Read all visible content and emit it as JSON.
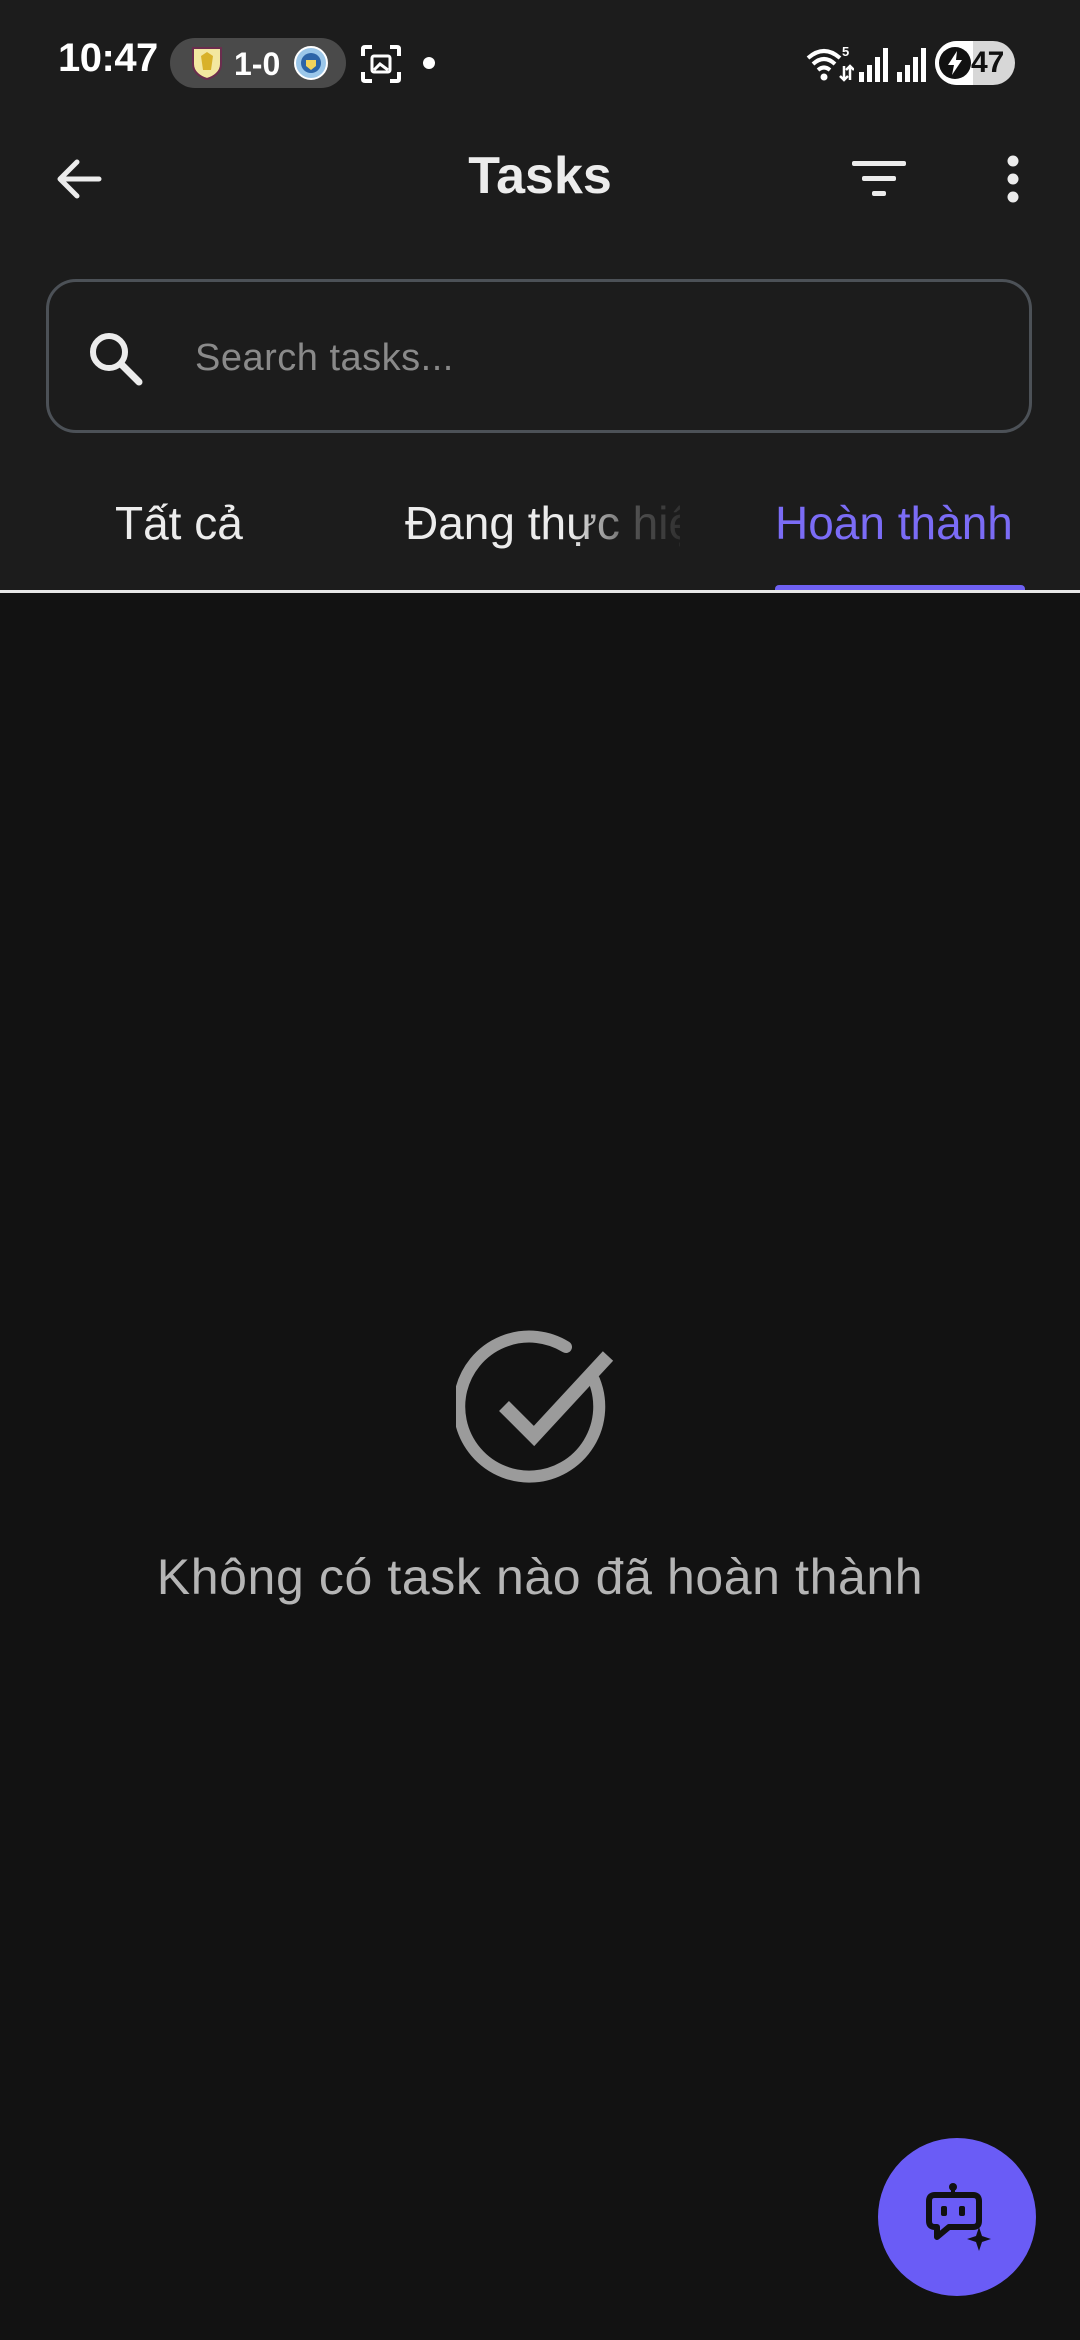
{
  "status_bar": {
    "time": "10:47",
    "score": "1-0",
    "battery_level": "47",
    "battery_fraction": 0.47,
    "icons": [
      "aston-villa-crest-icon",
      "man-city-crest-icon",
      "screenshot-icon",
      "notification-dot-icon",
      "wifi-icon",
      "signal-icon",
      "signal-icon",
      "charging-bolt-icon"
    ]
  },
  "app_bar": {
    "title": "Tasks",
    "back_icon": "arrow-left-icon",
    "filter_icon": "filter-icon",
    "more_icon": "more-vertical-icon"
  },
  "search": {
    "placeholder": "Search tasks...",
    "value": "",
    "icon": "search-icon"
  },
  "tabs": [
    {
      "label": "Tất cả",
      "selected": false
    },
    {
      "label": "Đang thực hiện",
      "selected": false
    },
    {
      "label": "Hoàn thành",
      "selected": true
    }
  ],
  "empty_state": {
    "icon": "check-circle-icon",
    "message": "Không có task nào đã hoàn thành"
  },
  "fab": {
    "icon": "ai-chat-bot-icon"
  },
  "colors": {
    "background": "#121212",
    "surface": "#1c1c1c",
    "accent": "#6a5cf6",
    "tab_selected": "#7b6cf6",
    "muted_text": "#b5b5b5"
  }
}
